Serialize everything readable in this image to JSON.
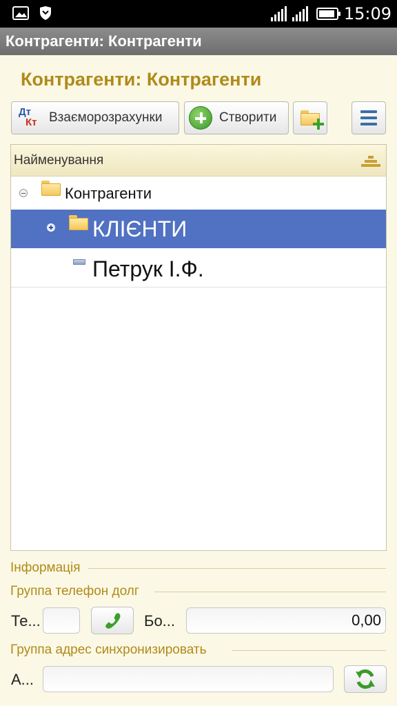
{
  "status": {
    "time": "15:09",
    "icons": [
      "gallery-icon",
      "shield-icon",
      "signal-icon",
      "battery-icon"
    ]
  },
  "app": {
    "window_title": "Контрагенти: Контрагенти"
  },
  "form": {
    "title": "Контрагенти: Контрагенти"
  },
  "toolbar": {
    "mutual_label": "Взаєморозрахунки",
    "mutual_icon_top": "Дт",
    "mutual_icon_bottom": "Кт",
    "create_label": "Створити",
    "add_folder_icon": "add-folder-icon",
    "menu_icon": "menu-icon"
  },
  "tree": {
    "column_header": "Найменування",
    "rows": [
      {
        "label": "Контрагенти",
        "type": "folder",
        "expanded": true,
        "selected": false
      },
      {
        "label": "КЛІЄНТИ",
        "type": "folder",
        "expanded": false,
        "selected": true
      },
      {
        "label": "Петрук І.Ф.",
        "type": "item",
        "selected": false
      }
    ]
  },
  "info": {
    "group_title": "Інформація",
    "phone_group_title": "Группа телефон долг",
    "phone_label": "Те...",
    "phone_value": "",
    "debt_label": "Бо...",
    "debt_value": "0,00",
    "address_group_title": "Группа адрес синхронизировать",
    "address_label": "А...",
    "address_value": ""
  },
  "colors": {
    "accent": "#b08a1a",
    "selection": "#5171c2",
    "titlebar": "#7a7a7a",
    "background": "#fbf8e5"
  }
}
